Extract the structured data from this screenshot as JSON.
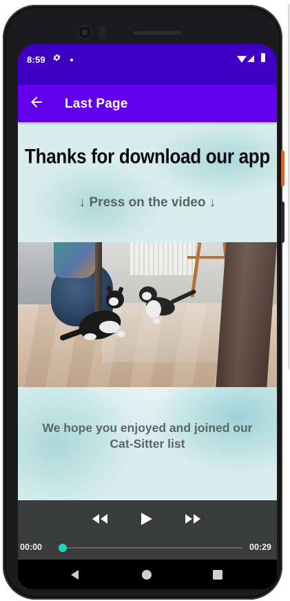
{
  "status_bar": {
    "time": "8:59",
    "settings_icon": "gear-icon",
    "notification_icon": "dot-icon",
    "wifi_icon": "wifi-icon",
    "signal_icon": "cell-signal-icon",
    "battery_icon": "battery-icon"
  },
  "app_bar": {
    "back_icon": "arrow-left-icon",
    "title": "Last Page"
  },
  "content": {
    "headline": "Thanks for download our app",
    "press_hint": "↓ Press on the video ↓",
    "thanks_message_line1": "We hope you enjoyed and joined our",
    "thanks_message_line2": "Cat-Sitter list"
  },
  "video_player": {
    "rewind_icon": "rewind-icon",
    "play_icon": "play-icon",
    "fast_forward_icon": "fast-forward-icon",
    "elapsed": "00:00",
    "duration": "00:29",
    "progress_fraction": 0.02
  },
  "nav_bar": {
    "back_icon": "triangle-back-icon",
    "home_icon": "circle-home-icon",
    "recents_icon": "square-recents-icon"
  },
  "colors": {
    "status_bar": "#3e00c2",
    "app_bar": "#6200ee",
    "seek_accent": "#1fd6bd",
    "controls_bg": "#3a3b3b"
  }
}
